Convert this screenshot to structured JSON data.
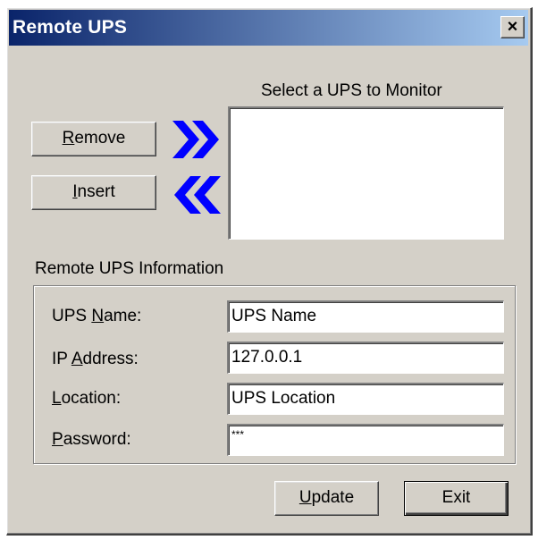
{
  "window": {
    "title": "Remote UPS",
    "close_label": "×"
  },
  "monitor": {
    "heading": "Select a UPS to Monitor"
  },
  "buttons": {
    "remove": {
      "mnemonic": "R",
      "rest": "emove"
    },
    "insert": {
      "mnemonic": "I",
      "rest": "nsert"
    },
    "update": {
      "mnemonic": "U",
      "rest": "pdate"
    },
    "exit": {
      "label": "Exit"
    }
  },
  "info": {
    "heading": "Remote UPS Information",
    "fields": [
      {
        "pre": "UPS ",
        "mnemonic": "N",
        "post": "ame:",
        "value": "UPS Name"
      },
      {
        "pre": "IP ",
        "mnemonic": "A",
        "post": "ddress:",
        "value": "127.0.0.1"
      },
      {
        "pre": "",
        "mnemonic": "L",
        "post": "ocation:",
        "value": "UPS Location"
      },
      {
        "pre": "",
        "mnemonic": "P",
        "post": "assword:",
        "value": "***"
      }
    ]
  },
  "icons": {
    "add_arrow": "double-chevron-right-icon",
    "remove_arrow": "double-chevron-left-icon"
  },
  "colors": {
    "arrow": "#0000ff",
    "title_start": "#0a246a",
    "title_end": "#a6caf0",
    "face": "#d4d0c8"
  }
}
